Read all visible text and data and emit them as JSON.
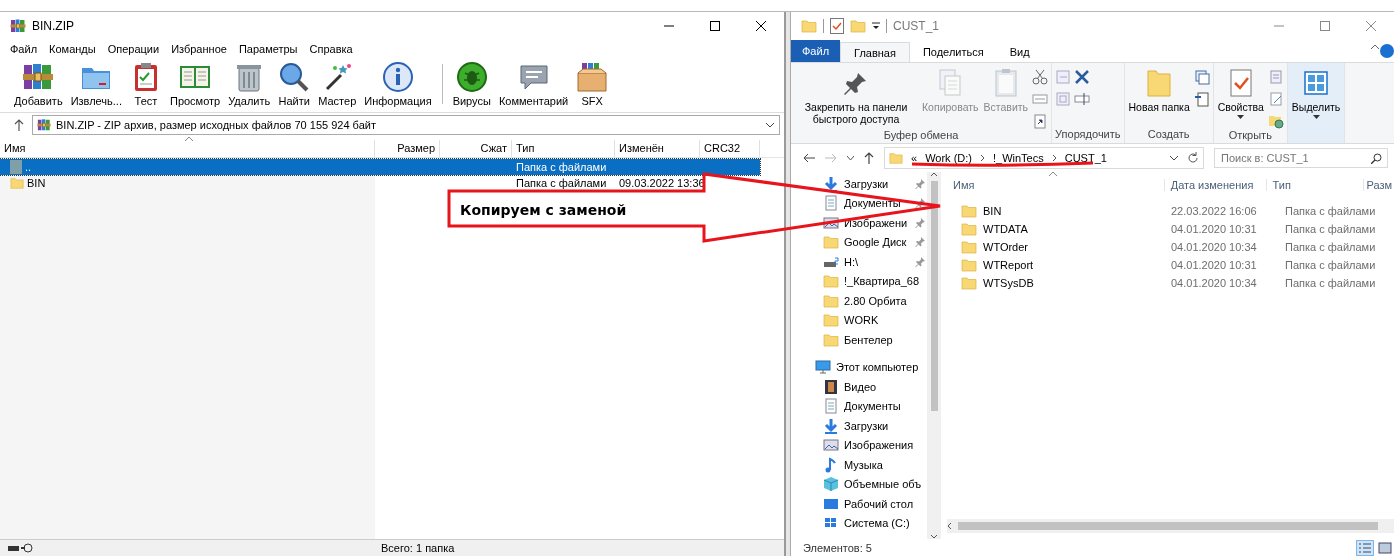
{
  "archiver": {
    "window": {
      "title": "BIN.ZIP"
    },
    "menu": [
      "Файл",
      "Команды",
      "Операции",
      "Избранное",
      "Параметры",
      "Справка"
    ],
    "toolbar": {
      "groups": [
        {
          "buttons": [
            "Добавить",
            "Извлечь...",
            "Тест",
            "Просмотр",
            "Удалить",
            "Найти",
            "Мастер",
            "Информация"
          ]
        },
        {
          "buttons": [
            "Вирусы",
            "Комментарий",
            "SFX"
          ]
        }
      ]
    },
    "address": "BIN.ZIP - ZIP архив, размер исходных файлов 70 155 924 байт",
    "table": {
      "columns": [
        "Имя",
        "Размер",
        "Сжат",
        "Тип",
        "Изменён",
        "CRC32"
      ],
      "rows": [
        {
          "kind": "up",
          "name": "..",
          "type": "Папка с файлами",
          "selected": true
        },
        {
          "kind": "folder",
          "name": "BIN",
          "type": "Папка с файлами",
          "modified": "09.03.2022 13:36",
          "selected": false
        }
      ]
    },
    "status_bar": "Всего: 1 папка"
  },
  "explorer": {
    "window": {
      "title": "CUST_1"
    },
    "file_button": "Файл",
    "tabs": [
      {
        "label": "Главная",
        "selected": true
      },
      {
        "label": "Поделиться",
        "selected": false
      },
      {
        "label": "Вид",
        "selected": false
      }
    ],
    "ribbon": {
      "groups": [
        {
          "label": "Буфер обмена",
          "buttons": [
            {
              "label": "Закрепить на панели быстрого доступа",
              "disabled": false,
              "dropdown": false
            },
            {
              "label": "Копировать",
              "disabled": true,
              "dropdown": false
            },
            {
              "label": "Вставить",
              "disabled": true,
              "dropdown": false
            }
          ]
        },
        {
          "label": "Упорядочить"
        },
        {
          "label": "Создать",
          "buttons": [
            {
              "label": "Новая папка",
              "disabled": false,
              "dropdown": false
            }
          ]
        },
        {
          "label": "Открыть",
          "buttons": [
            {
              "label": "Свойства",
              "disabled": false,
              "dropdown": true
            }
          ]
        },
        {
          "buttons": [
            {
              "label": "Выделить",
              "disabled": false,
              "dropdown": true
            }
          ]
        }
      ]
    },
    "address": {
      "overflow_mark": "«",
      "path": [
        "Work (D:)",
        "!_WinTecs",
        "CUST_1"
      ]
    },
    "search": {
      "placeholder": "Поиск в: CUST_1"
    },
    "nav": {
      "quick_access": [
        {
          "label": "Загрузки",
          "pinned": true
        },
        {
          "label": "Документы",
          "pinned": true
        },
        {
          "label": "Изображени",
          "pinned": true
        },
        {
          "label": "Google Диск",
          "pinned": true
        },
        {
          "label": "H:\\",
          "pinned": true
        },
        {
          "label": "!_Квартира_68",
          "pinned": false
        },
        {
          "label": "2.80 Орбита",
          "pinned": false
        },
        {
          "label": "WORK",
          "pinned": false
        },
        {
          "label": "Бентелер",
          "pinned": false
        }
      ],
      "this_pc": {
        "label": "Этот компьютер",
        "items": [
          "Видео",
          "Документы",
          "Загрузки",
          "Изображения",
          "Музыка",
          "Объемные объ",
          "Рабочий стол",
          "Система (C:)"
        ]
      }
    },
    "files": {
      "columns": [
        "Имя",
        "Дата изменения",
        "Тип",
        "Разм"
      ],
      "rows": [
        {
          "name": "BIN",
          "modified": "22.03.2022 16:06",
          "type": "Папка с файлами"
        },
        {
          "name": "WTDATA",
          "modified": "04.01.2020 10:31",
          "type": "Папка с файлами"
        },
        {
          "name": "WTOrder",
          "modified": "04.01.2020 10:34",
          "type": "Папка с файлами"
        },
        {
          "name": "WTReport",
          "modified": "04.01.2020 10:31",
          "type": "Папка с файлами"
        },
        {
          "name": "WTSysDB",
          "modified": "04.01.2020 10:34",
          "type": "Папка с файлами"
        }
      ]
    },
    "status_bar": "Элементов: 5",
    "views": [
      {
        "selected": true
      },
      {
        "selected": false
      }
    ]
  },
  "annotation": {
    "text": "Копируем с заменой"
  }
}
